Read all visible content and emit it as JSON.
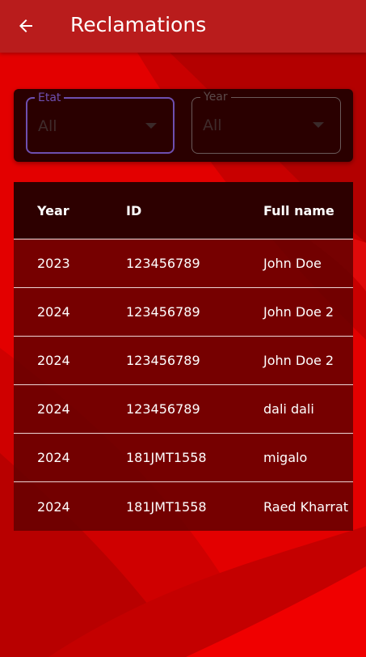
{
  "app": {
    "title": "Reclamations"
  },
  "filters": {
    "etat": {
      "label": "Etat",
      "value": "All"
    },
    "year": {
      "label": "Year",
      "value": "All"
    }
  },
  "table": {
    "headers": {
      "year": "Year",
      "id": "ID",
      "full_name": "Full name"
    },
    "rows": [
      {
        "year": "2023",
        "id": "123456789",
        "full_name": "John Doe"
      },
      {
        "year": "2024",
        "id": "123456789",
        "full_name": "John Doe 2"
      },
      {
        "year": "2024",
        "id": "123456789",
        "full_name": "John Doe 2"
      },
      {
        "year": "2024",
        "id": "123456789",
        "full_name": "dali dali"
      },
      {
        "year": "2024",
        "id": "181JMT1558",
        "full_name": "migalo"
      },
      {
        "year": "2024",
        "id": "181JMT1558",
        "full_name": "Raed  Kharrat"
      }
    ]
  },
  "icons": {
    "back": "arrow-left-icon",
    "dropdown": "chevron-down-icon"
  },
  "colors": {
    "appbar": "#b91c1c",
    "background": "#d90000",
    "table_header": "#2d0000",
    "focus": "#6e4fb0"
  }
}
